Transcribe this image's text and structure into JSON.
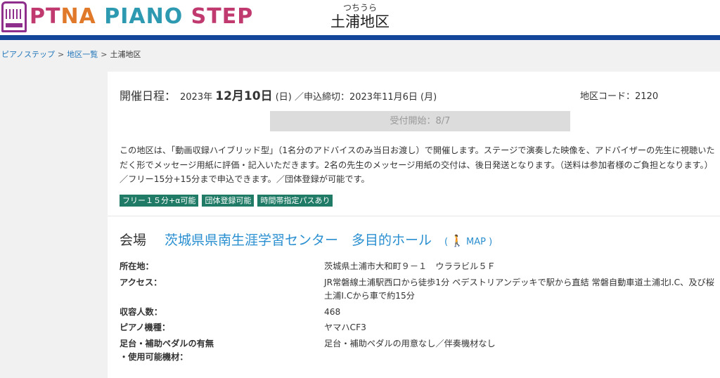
{
  "header": {
    "logo": {
      "part1": "PT",
      "part2": "NA ",
      "part3": "PIANO ",
      "part4": "STEP"
    },
    "area_ruby": "つちうら",
    "area_title": "土浦地区"
  },
  "breadcrumb": {
    "home": "ピアノステップ",
    "list": "地区一覧",
    "current": "土浦地区",
    "separator": ">"
  },
  "schedule": {
    "label": "開催日程：",
    "year": "2023年",
    "date": "12月10日",
    "weekday_and_deadline": "(日) ／申込締切：2023年11月6日 (月)",
    "area_code": "地区コード：2120"
  },
  "accept_button": "受付開始：8/7",
  "description": "この地区は、「動画収録ハイブリッド型」（1名分のアドバイスのみ当日お渡し）で開催します。ステージで演奏した映像を、アドバイザーの先生に視聴いただく形でメッセージ用紙に評価・記入いただきます。2名の先生のメッセージ用紙の交付は、後日発送となります。（送料は参加者様のご負担となります。）／フリー15分+15分まで申込できます。／団体登録が可能です。",
  "tags": [
    "フリー１５分+α可能",
    "団体登録可能",
    "時間帯指定パスあり"
  ],
  "venue": {
    "label": "会場",
    "name": "茨城県県南生涯学習センター　多目的ホール",
    "map_open": "(",
    "map_label": "MAP",
    "map_close": ")"
  },
  "info": [
    {
      "key": "所在地：",
      "value": "茨城県土浦市大和町９－１　ウララビル５Ｆ"
    },
    {
      "key": "アクセス：",
      "value": "JR常磐線土浦駅西口から徒歩1分 ペデストリアンデッキで駅から直結 常磐自動車道土浦北I.C、及び桜土浦I.Cから車で約15分"
    },
    {
      "key": "収容人数：",
      "value": "468"
    },
    {
      "key": "ピアノ機種：",
      "value": "ヤマハCF3"
    },
    {
      "key": "足台・補助ペダルの有無\n・使用可能機材：",
      "value": "足台・補助ペダルの用意なし／伴奏機材なし"
    }
  ]
}
